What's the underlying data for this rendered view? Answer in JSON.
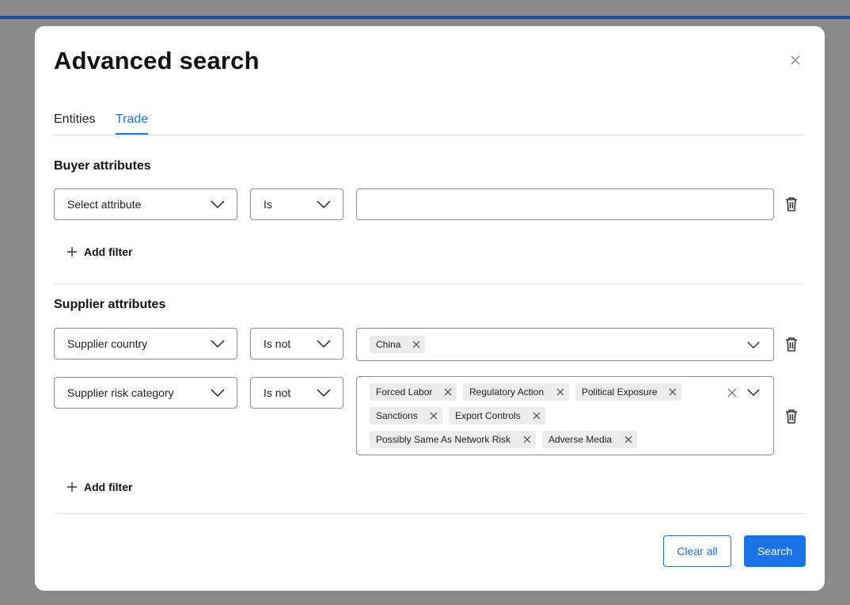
{
  "modal": {
    "title": "Advanced search",
    "tabs": [
      {
        "label": "Entities",
        "active": false
      },
      {
        "label": "Trade",
        "active": true
      }
    ]
  },
  "buyer": {
    "title": "Buyer attributes",
    "filters": [
      {
        "attribute": "Select attribute",
        "operator": "Is",
        "value": ""
      }
    ],
    "add_filter_label": "Add filter"
  },
  "supplier": {
    "title": "Supplier attributes",
    "filters": [
      {
        "attribute": "Supplier country",
        "operator": "Is not",
        "chips": [
          "China"
        ]
      },
      {
        "attribute": "Supplier risk category",
        "operator": "Is not",
        "chips": [
          "Forced Labor",
          "Regulatory Action",
          "Political Exposure",
          "Sanctions",
          "Export Controls",
          "Possibly Same As Network Risk",
          "Adverse Media"
        ]
      }
    ],
    "add_filter_label": "Add filter"
  },
  "footer": {
    "clear_label": "Clear all",
    "search_label": "Search"
  },
  "colors": {
    "accent": "#1a73e8",
    "top_bar": "#1a4fa0",
    "overlay": "#8a8a8a",
    "chip_bg": "#ececec"
  },
  "icons": {
    "close": "close-icon",
    "chevron": "chevron-down-icon",
    "delete": "trash-icon",
    "add": "plus-icon",
    "chip_remove": "close-icon"
  }
}
